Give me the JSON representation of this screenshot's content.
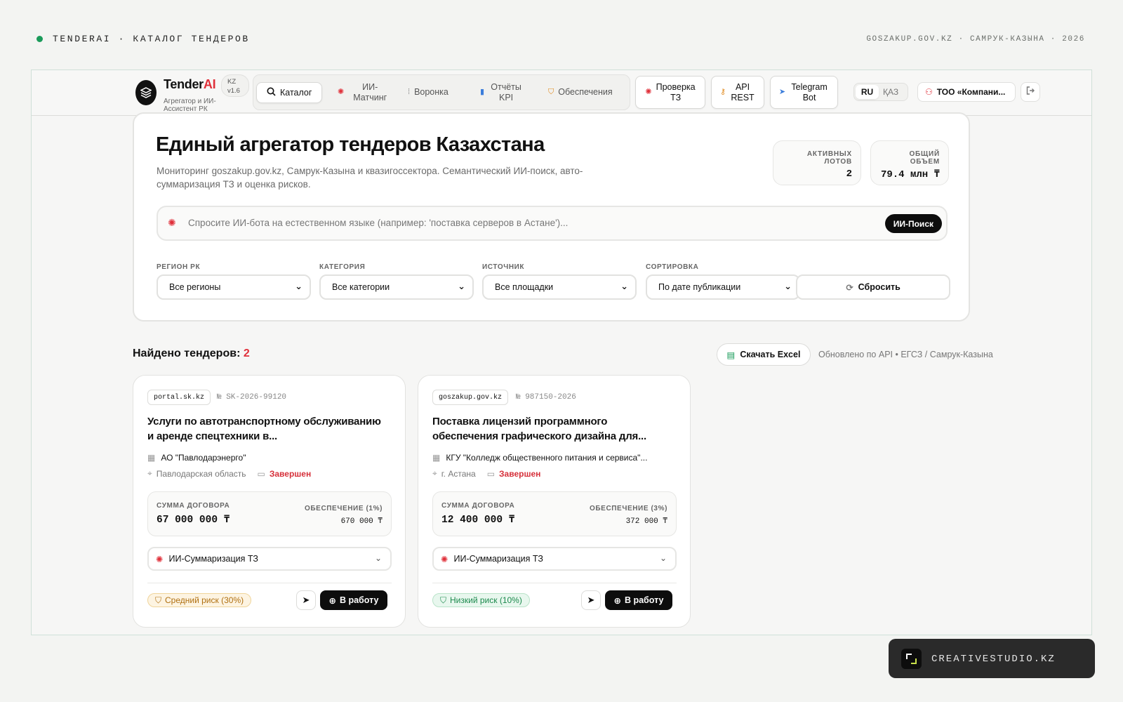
{
  "outer": {
    "left_label": "TENDERAI · КАТАЛОГ ТЕНДЕРОВ",
    "right_label": "GOSZAKUP.GOV.KZ · САМРУК-КАЗЫНА · 2026"
  },
  "brand": {
    "name_a": "Tender",
    "name_b": "AI",
    "subtitle": "Агрегатор и ИИ-Ассистент РК",
    "version_line1": "KZ",
    "version_line2": "v1.6"
  },
  "nav": {
    "catalog": "Каталог",
    "matching": "ИИ-Матчинг",
    "funnel": "Воронка",
    "reports": "Отчёты KPI",
    "guarantees": "Обеспечения"
  },
  "actions": {
    "check_tz": "Проверка ТЗ",
    "api": "API REST",
    "telegram": "Telegram Bot"
  },
  "lang": {
    "ru": "RU",
    "kz": "ҚАЗ"
  },
  "user": {
    "company": "ТОО «Компани..."
  },
  "hero": {
    "title": "Единый агрегатор тендеров Казахстана",
    "description": "Мониторинг goszakup.gov.kz, Самрук-Казына и квазигоссектора. Семантический ИИ-поиск, авто-суммаризация ТЗ и оценка рисков.",
    "stat_lots_label": "АКТИВНЫХ ЛОТОВ",
    "stat_lots_value": "2",
    "stat_volume_label": "ОБЩИЙ ОБЪЕМ",
    "stat_volume_value": "79.4 млн ₸"
  },
  "search": {
    "placeholder": "Спросите ИИ-бота на естественном языке (например: 'поставка серверов в Астане')...",
    "button": "ИИ-Поиск"
  },
  "filters": {
    "region_label": "РЕГИОН РК",
    "region_value": "Все регионы",
    "category_label": "КАТЕГОРИЯ",
    "category_value": "Все категории",
    "source_label": "ИСТОЧНИК",
    "source_value": "Все площадки",
    "sort_label": "СОРТИРОВКА",
    "sort_value": "По дате публикации",
    "reset": "Сбросить"
  },
  "results": {
    "found_label": "Найдено тендеров:",
    "found_count": "2",
    "excel": "Скачать Excel",
    "updated": "Обновлено по API • ЕГСЗ / Самрук-Казына"
  },
  "cards": [
    {
      "source": "portal.sk.kz",
      "number": "№ SK-2026-99120",
      "title": "Услуги по автотранспортному обслуживанию и аренде спецтехники в...",
      "org": "АО \"Павлодарэнерго\"",
      "region": "Павлодарская область",
      "status": "Завершен",
      "sum_label": "СУММА ДОГОВОРА",
      "sum_value": "67 000 000 ₸",
      "guarantee_label": "ОБЕСПЕЧЕНИЕ (1%)",
      "guarantee_value": "670 000 ₸",
      "summary": "ИИ-Суммаризация ТЗ",
      "risk": "Средний риск (30%)",
      "work": "В работу"
    },
    {
      "source": "goszakup.gov.kz",
      "number": "№ 987150-2026",
      "title": "Поставка лицензий программного обеспечения графического дизайна для...",
      "org": "КГУ \"Колледж общественного питания и сервиса\"...",
      "region": "г. Астана",
      "status": "Завершен",
      "sum_label": "СУММА ДОГОВОРА",
      "sum_value": "12 400 000 ₸",
      "guarantee_label": "ОБЕСПЕЧЕНИЕ (3%)",
      "guarantee_value": "372 000 ₸",
      "summary": "ИИ-Суммаризация ТЗ",
      "risk": "Низкий риск (10%)",
      "work": "В работу"
    }
  ],
  "studio": {
    "label": "CREATIVESTUDIO.KZ"
  },
  "colors": {
    "accent": "#e0303a",
    "dark": "#0d0d0d",
    "success": "#1a9b5a",
    "warning": "#b07011"
  }
}
